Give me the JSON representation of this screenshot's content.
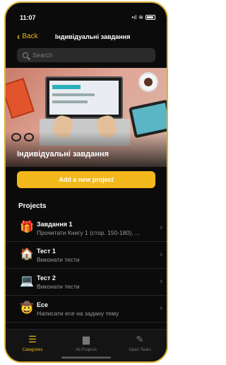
{
  "status_bar": {
    "time": "11:07",
    "signal": "•ıl",
    "wifi": "≋"
  },
  "nav": {
    "back_label": "Back",
    "title": "Індивідуальні завдання"
  },
  "search": {
    "placeholder": "Search"
  },
  "hero": {
    "title": "Індивідуальні завдання"
  },
  "add_button": {
    "label": "Add a new project"
  },
  "projects": {
    "title": "Projects",
    "items": [
      {
        "icon": "🎁",
        "icon_name": "gift-icon",
        "title": "Завдання 1",
        "subtitle": "Прочитати Книгу 1 (стор. 150-180), ..."
      },
      {
        "icon": "🏠",
        "icon_name": "house-icon",
        "title": "Тест 1",
        "subtitle": "Виконати тести"
      },
      {
        "icon": "💻",
        "icon_name": "laptop-icon",
        "title": "Тест 2",
        "subtitle": "Виконати тести"
      },
      {
        "icon": "🤠",
        "icon_name": "cowboy-face-icon",
        "title": "Есе",
        "subtitle": "Написати есе на задану тему"
      }
    ]
  },
  "tabs": [
    {
      "icon": "☰",
      "icon_name": "categories-icon",
      "label": "Categories",
      "active": true
    },
    {
      "icon": "▆",
      "icon_name": "folder-icon",
      "label": "All Projects",
      "active": false
    },
    {
      "icon": "✎",
      "icon_name": "edit-tasks-icon",
      "label": "Open Tasks",
      "active": false
    }
  ],
  "colors": {
    "accent": "#f3b81b",
    "background": "#0b0b0b",
    "frame": "#d9b436"
  }
}
